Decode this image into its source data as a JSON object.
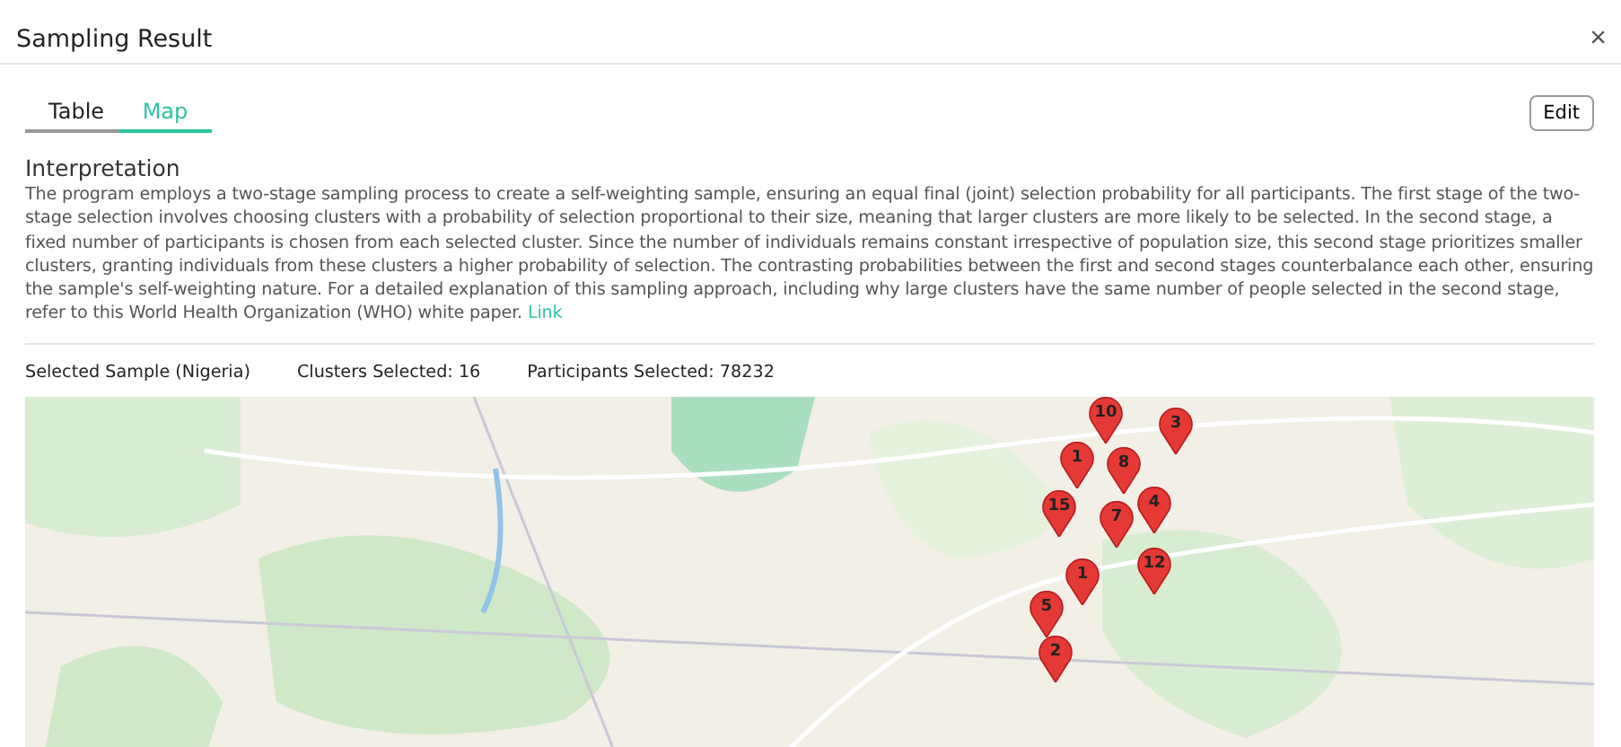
{
  "dialog": {
    "title": "Sampling Result",
    "close": "×"
  },
  "tabs": [
    {
      "label": "Table",
      "selected": false
    },
    {
      "label": "Map",
      "selected": true
    }
  ],
  "edit_button": "Edit",
  "interpretation": {
    "heading": "Interpretation",
    "text": "The program employs a two-stage sampling process to create a self-weighting sample, ensuring an equal final (joint) selection probability for all participants. The first stage of the two-stage selection involves choosing clusters with a probability of selection proportional to their size, meaning that larger clusters are more likely to be selected. In the second stage, a fixed number of participants is chosen from each selected cluster. Since the number of individuals remains constant irrespective of population size, this second stage prioritizes smaller clusters, granting individuals from these clusters a higher probability of selection. The contrasting probabilities between the first and second stages counterbalance each other, ensuring the sample's self-weighting nature. For a detailed explanation of this sampling approach, including why large clusters have the same number of people selected in the second stage, refer to this World Health Organization (WHO) white paper.",
    "link": "Link"
  },
  "summary": [
    "Selected Sample (Nigeria)",
    "Clusters Selected: 16",
    "Participants Selected: 78232"
  ],
  "map": {
    "kind": "picture",
    "markers": [
      {
        "label": "10"
      },
      {
        "label": "1"
      },
      {
        "label": "8"
      },
      {
        "label": "3"
      },
      {
        "label": "15"
      },
      {
        "label": "4"
      },
      {
        "label": "7"
      },
      {
        "label": "1"
      },
      {
        "label": "12"
      },
      {
        "label": "5"
      },
      {
        "label": "2"
      }
    ]
  }
}
